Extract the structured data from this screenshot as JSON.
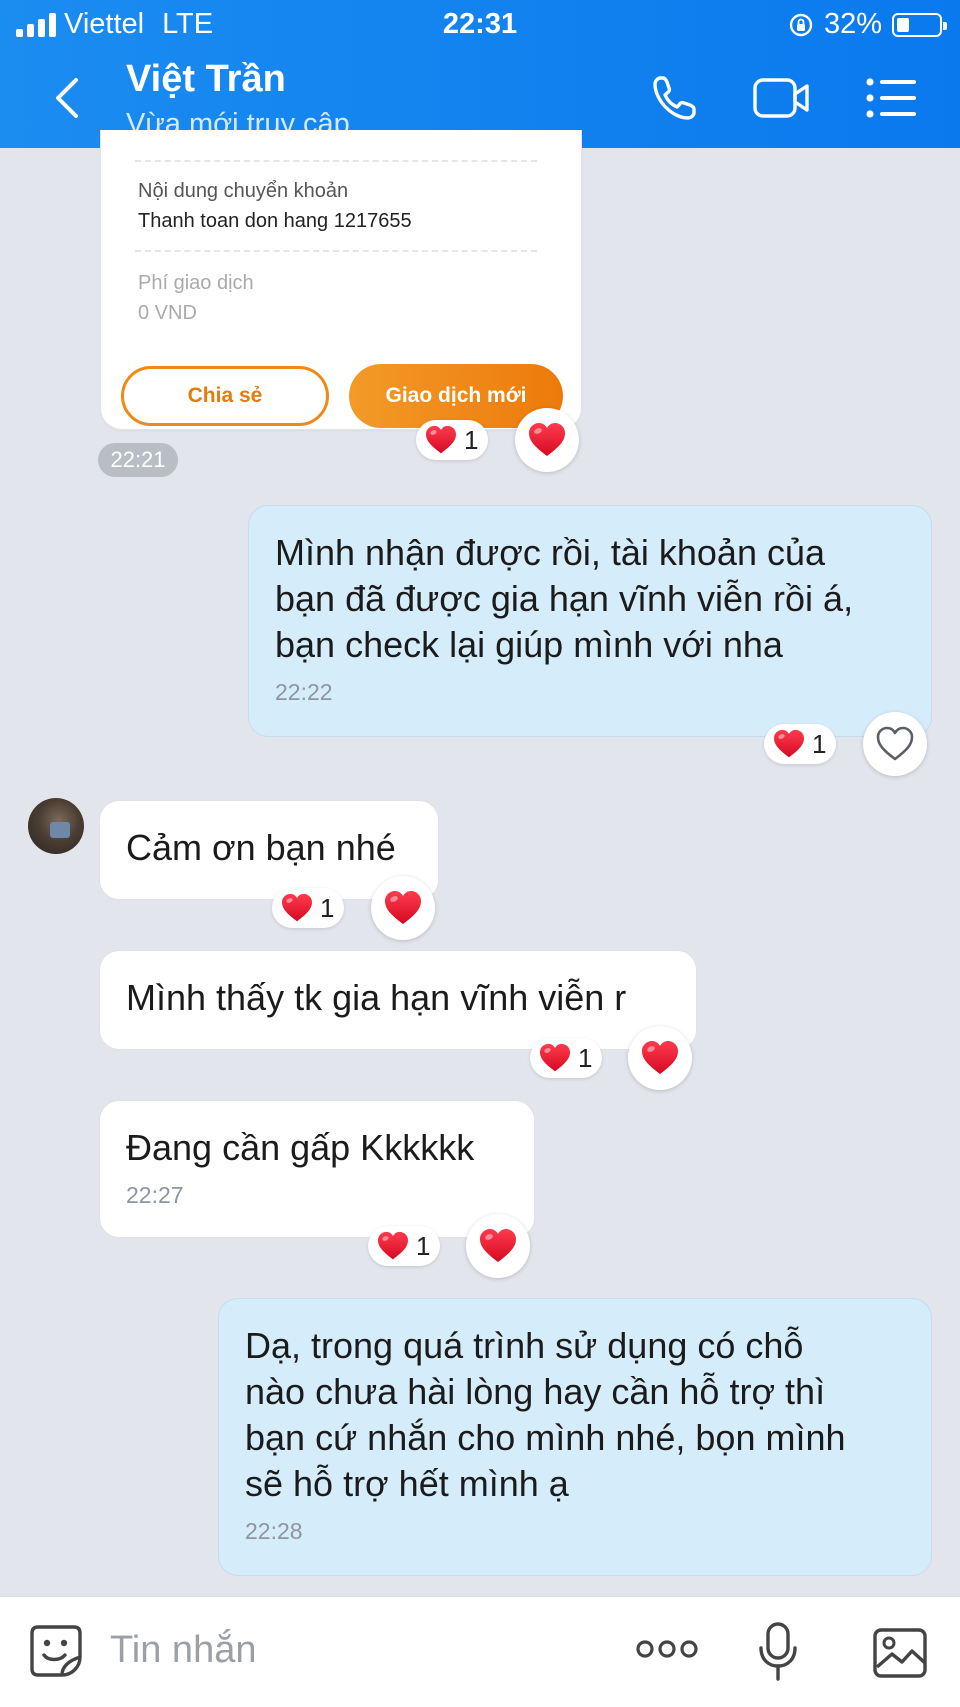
{
  "status_bar": {
    "carrier": "Viettel",
    "network": "LTE",
    "time": "22:31",
    "battery": "32%"
  },
  "header": {
    "title": "Việt Trần",
    "subtitle": "Vừa mới truy cập",
    "icons": [
      "back-chevron-icon",
      "phone-icon",
      "video-call-icon",
      "menu-list-icon"
    ]
  },
  "receipt_card": {
    "transfer_content_label": "Nội dung chuyển khoản",
    "transfer_content_value": "Thanh toan don hang 1217655",
    "fee_label": "Phí giao dịch",
    "fee_value": "0 VND",
    "share_button": "Chia sẻ",
    "new_transaction_button": "Giao dịch mới",
    "reaction_count": "1",
    "time": "22:21"
  },
  "messages": [
    {
      "direction": "outgoing",
      "text_lines": [
        "Mình nhận được rồi, tài khoản của",
        "bạn đã được gia hạn vĩnh viễn rồi á,",
        "bạn check lại giúp mình với nha"
      ],
      "time": "22:22",
      "reaction_count": "1"
    },
    {
      "direction": "incoming",
      "text": "Cảm ơn bạn nhé",
      "reaction_count": "1"
    },
    {
      "direction": "incoming",
      "text": "Mình thấy tk gia hạn vĩnh viễn r",
      "reaction_count": "1"
    },
    {
      "direction": "incoming",
      "text": "Đang cần gấp Kkkkkk",
      "time": "22:27",
      "reaction_count": "1"
    },
    {
      "direction": "outgoing",
      "text_lines": [
        "Dạ, trong quá trình sử dụng có chỗ",
        "nào chưa hài lòng hay cần hỗ trợ thì",
        "bạn cứ nhắn cho mình nhé, bọn mình",
        "sẽ hỗ trợ hết mình ạ"
      ],
      "time": "22:28"
    }
  ],
  "input_bar": {
    "placeholder": "Tin nhắn",
    "icons": [
      "sticker-icon",
      "more-dots-icon",
      "microphone-icon",
      "image-icon"
    ]
  },
  "colors": {
    "header_blue": "#0a79ee",
    "outgoing_bubble": "#d5ecfb",
    "incoming_bubble": "#ffffff",
    "chat_background": "#e2e5ec",
    "orange_accent": "#ec7a0a",
    "heart_red": "#e5172f"
  }
}
